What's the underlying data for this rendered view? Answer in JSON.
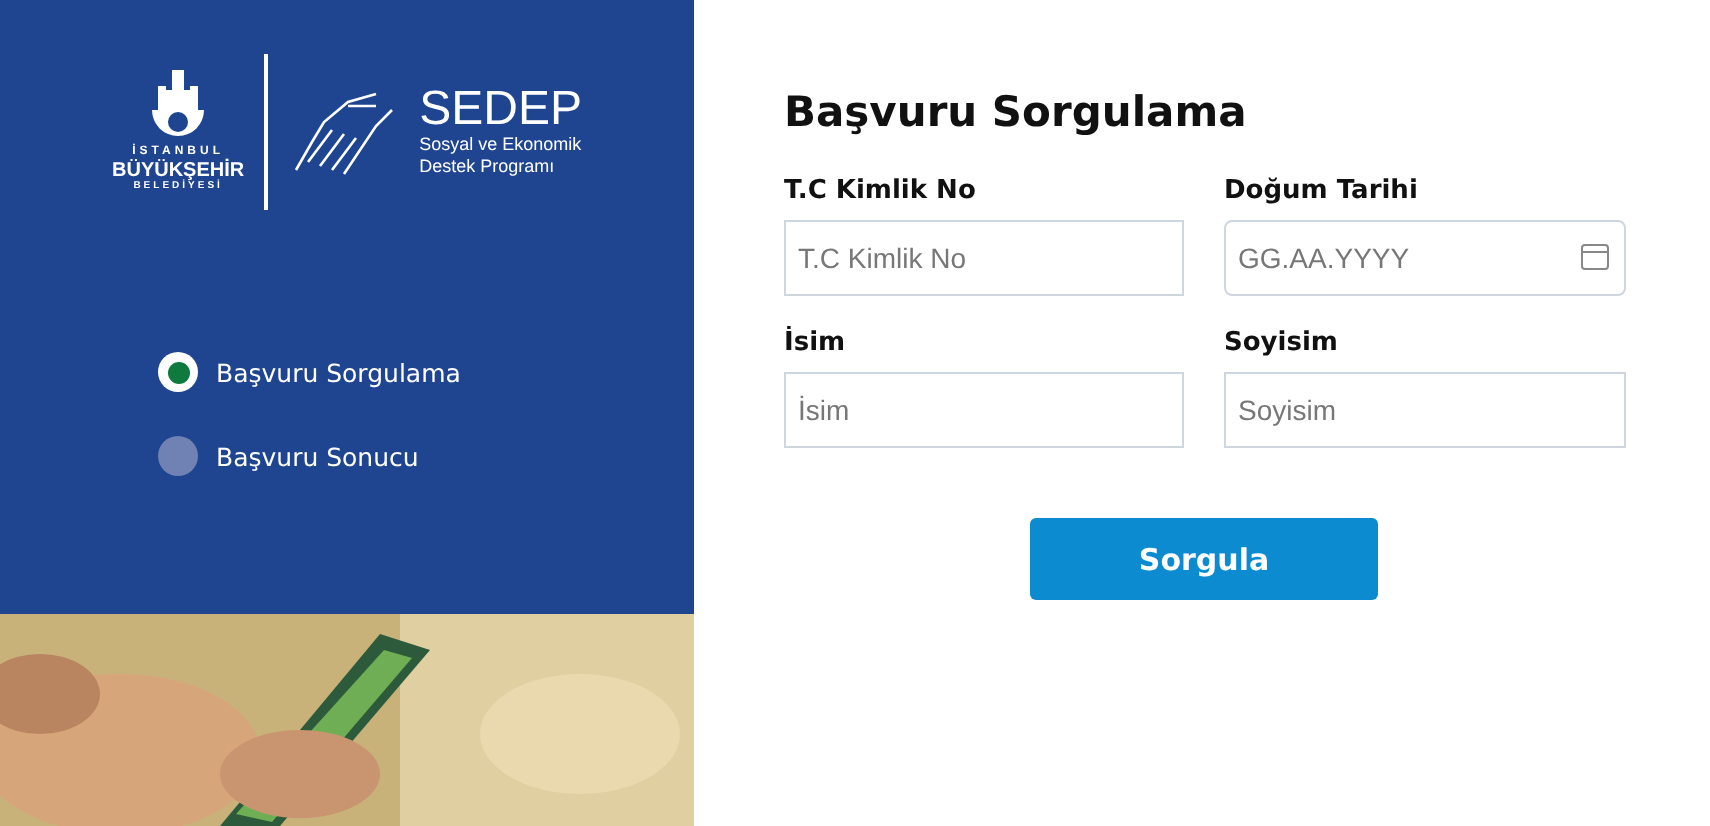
{
  "logo": {
    "city_line_1": "İSTANBUL",
    "city_line_2": "BÜYÜKŞEHİR",
    "city_line_3": "BELEDİYESİ",
    "program_name": "SEDEP",
    "program_line_1": "Sosyal ve Ekonomik",
    "program_line_2": "Destek Programı"
  },
  "steps": [
    {
      "label": "Başvuru Sorgulama",
      "selected": true
    },
    {
      "label": "Başvuru Sonucu",
      "selected": false
    }
  ],
  "form": {
    "title": "Başvuru Sorgulama",
    "fields": [
      {
        "label": "T.C Kimlik No",
        "placeholder": "T.C Kimlik No",
        "kind": "text"
      },
      {
        "label": "Doğum Tarihi",
        "placeholder": "GG.AA.YYYY",
        "kind": "date"
      },
      {
        "label": "İsim",
        "placeholder": "İsim",
        "kind": "text"
      },
      {
        "label": "Soyisim",
        "placeholder": "Soyisim",
        "kind": "text"
      }
    ],
    "button": "Sorgula"
  }
}
